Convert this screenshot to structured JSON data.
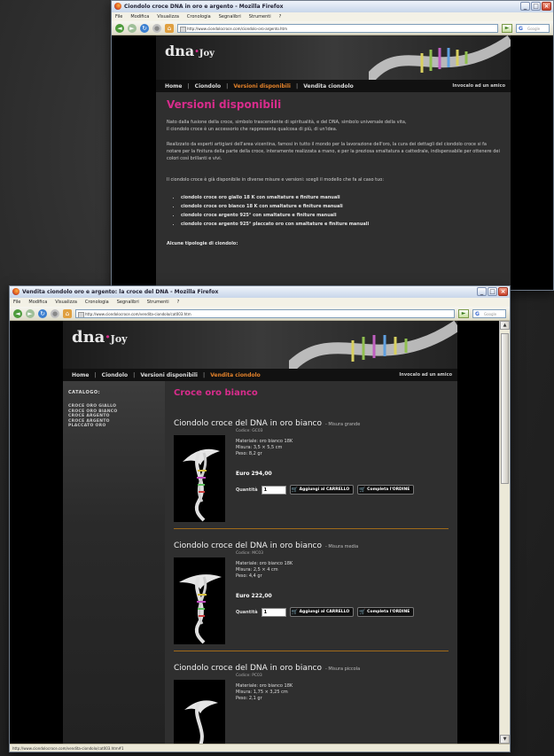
{
  "back_window": {
    "title": "Ciondolo croce DNA in oro e argento - Mozilla Firefox",
    "menu": [
      "File",
      "Modifica",
      "Visualizza",
      "Cronologia",
      "Segnalibri",
      "Strumenti",
      "?"
    ],
    "url": "http://www.ciondolocroce.com/ciondolo-oro-argento.htm",
    "search_placeholder": "Google",
    "site": {
      "logo_text": "dna",
      "logo_sub": "Joy",
      "nav": [
        "Home",
        "Ciondolo",
        "Versioni disponibili",
        "Vendita ciondolo"
      ],
      "nav_active": "Versioni disponibili",
      "login": "Invocalo ad un amico",
      "heading": "Versioni disponibili",
      "p1": "Nato dalla fusione della croce, simbolo trascendente di spiritualità, e del DNA, simbolo universale della vita,",
      "p1b": "il ciondolo croce è un accessorio che rappresenta qualcosa di più, di un'idea.",
      "p2": "Realizzato da esperti artigiani dell'area vicentina, famosi in tutto il mondo per la lavorazione dell'oro, la cura dei dettagli del ciondolo croce si fa notare per la finitura della parte della croce, interamente realizzata a mano, e per la preziosa smaltatura a cattedrale, indispensabile per ottenere dei colori così brillanti e vivi.",
      "p3": "Il ciondolo croce è già disponibile in diverse misure e versioni: scegli il modello che fa al caso tuo:",
      "list": [
        "ciondolo croce oro giallo 18 K con smaltature e finiture manuali",
        "ciondolo croce oro bianco 18 K con smaltature e finiture manuali",
        "ciondolo croce argento 925° con smaltature e finiture manuali",
        "ciondolo croce argento 925° placcato oro con smaltature e finiture manuali"
      ],
      "subhead": "Alcune tipologie di ciondolo:"
    }
  },
  "front_window": {
    "title": "Vendita ciondolo oro e argento: la croce del DNA - Mozilla Firefox",
    "menu": [
      "File",
      "Modifica",
      "Visualizza",
      "Cronologia",
      "Segnalibri",
      "Strumenti",
      "?"
    ],
    "url": "http://www.ciondolocroce.com/vendita-ciondolo/cat003.htm",
    "search_placeholder": "Google",
    "status": "http://www.ciondolocroce.com/vendita-ciondolo/cat003.htm#1",
    "site": {
      "logo_text": "dna",
      "logo_sub": "Joy",
      "nav": [
        "Home",
        "Ciondolo",
        "Versioni disponibili",
        "Vendita ciondolo"
      ],
      "nav_active": "Vendita ciondolo",
      "login": "Invocalo ad un amico",
      "catalog_title": "CATALOGO:",
      "catalog_items": [
        "CROCE ORO GIALLO",
        "CROCE ORO BIANCO",
        "CROCE ARGENTO",
        "CROCE ARGENTO",
        "PLACCATO ORO"
      ],
      "heading": "Croce oro bianco",
      "qty_label": "Quantità",
      "qty_value": "1",
      "cart_label": "Aggiungi al CARRELLO",
      "order_label": "Completa l'ORDINE",
      "products": [
        {
          "title": "Ciondolo croce del DNA in oro bianco",
          "size": "- Misura grande",
          "code": "Codice: GC03",
          "material": "Materiale: oro bianco 18K",
          "measure": "Misura: 3,5 × 5,5 cm",
          "weight": "Peso: 8,2 gr",
          "price": "Euro 294,00"
        },
        {
          "title": "Ciondolo croce del DNA in oro bianco",
          "size": "- Misura media",
          "code": "Codice: MC03",
          "material": "Materiale: oro bianco 18K",
          "measure": "Misura: 2,5 × 4 cm",
          "weight": "Peso: 4,4 gr",
          "price": "Euro 222,00"
        },
        {
          "title": "Ciondolo croce del DNA in oro bianco",
          "size": "- Misura piccola",
          "code": "Codice: PC03",
          "material": "Materiale: oro bianco 18K",
          "measure": "Misura: 1,75 × 3,25 cm",
          "weight": "Peso: 2,1 gr",
          "price": ""
        }
      ]
    }
  },
  "colors": {
    "accent_magenta": "#d82c8c",
    "nav_active_orange": "#e4822a",
    "divider_gold": "#a06a1a"
  }
}
